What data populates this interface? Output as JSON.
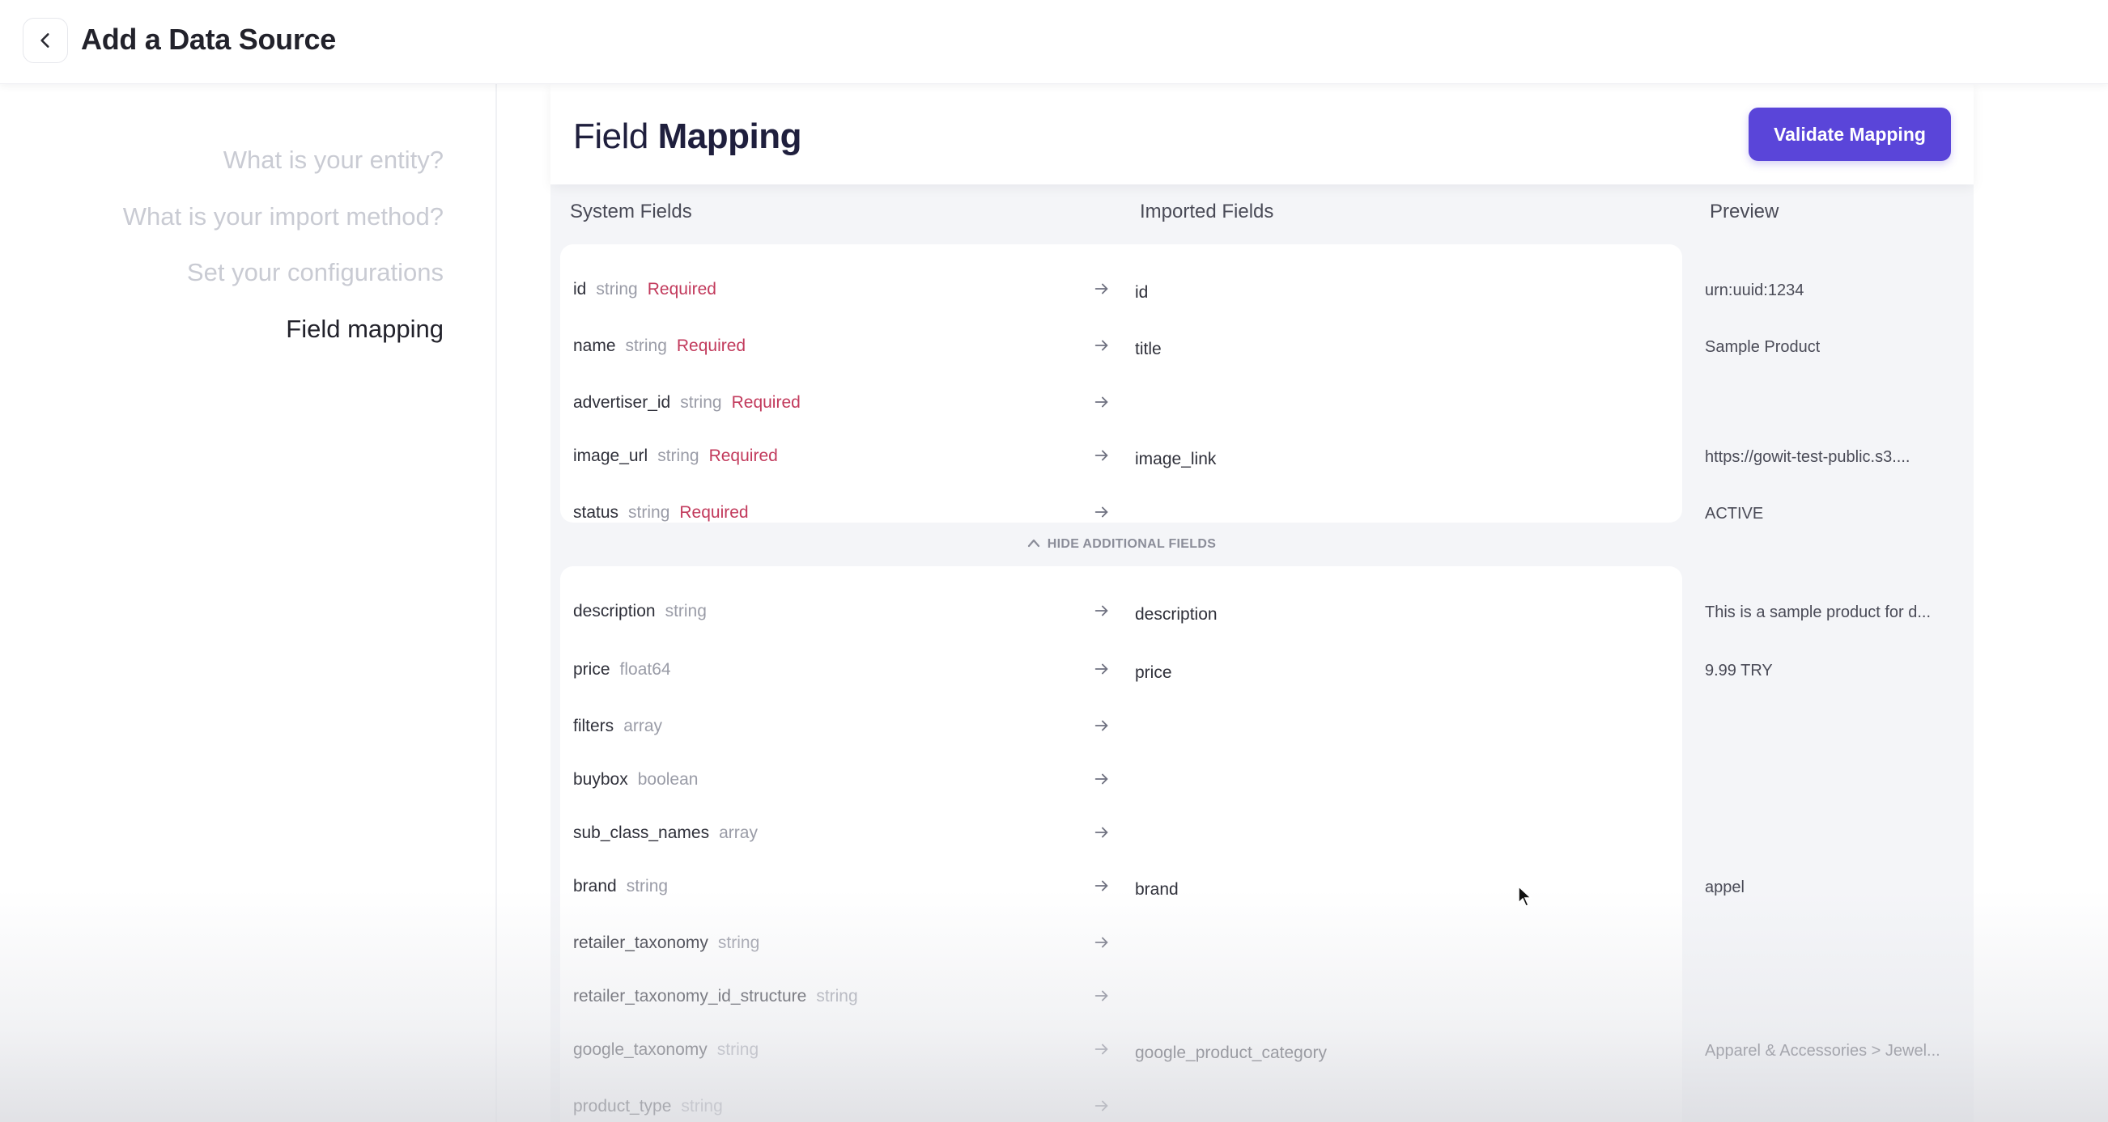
{
  "header": {
    "title": "Add a Data Source"
  },
  "sidebar": {
    "steps": [
      {
        "label": "What is your entity?"
      },
      {
        "label": "What is your import method?"
      },
      {
        "label": "Set your configurations"
      },
      {
        "label": "Field mapping"
      }
    ]
  },
  "main": {
    "title_light": "Field",
    "title_bold": "Mapping",
    "validate_label": "Validate Mapping",
    "columns": {
      "system": "System Fields",
      "imported": "Imported Fields",
      "preview": "Preview"
    },
    "toggle_label": "HIDE ADDITIONAL FIELDS"
  },
  "required_fields": [
    {
      "name": "id",
      "type": "string",
      "req": "Required",
      "imported": "id",
      "preview": "urn:uuid:1234"
    },
    {
      "name": "name",
      "type": "string",
      "req": "Required",
      "imported": "title",
      "preview": "Sample Product"
    },
    {
      "name": "advertiser_id",
      "type": "string",
      "req": "Required",
      "imported": "",
      "preview": ""
    },
    {
      "name": "image_url",
      "type": "string",
      "req": "Required",
      "imported": "image_link",
      "preview": "https://gowit-test-public.s3...."
    },
    {
      "name": "status",
      "type": "string",
      "req": "Required",
      "imported": "",
      "preview": "ACTIVE"
    }
  ],
  "additional_fields": [
    {
      "name": "description",
      "type": "string",
      "imported": "description",
      "preview": "This is a sample product for d..."
    },
    {
      "name": "price",
      "type": "float64",
      "imported": "price",
      "preview": "9.99 TRY"
    },
    {
      "name": "filters",
      "type": "array",
      "imported": "",
      "preview": ""
    },
    {
      "name": "buybox",
      "type": "boolean",
      "imported": "",
      "preview": ""
    },
    {
      "name": "sub_class_names",
      "type": "array",
      "imported": "",
      "preview": ""
    },
    {
      "name": "brand",
      "type": "string",
      "imported": "brand",
      "preview": "appel"
    },
    {
      "name": "retailer_taxonomy",
      "type": "string",
      "imported": "",
      "preview": ""
    },
    {
      "name": "retailer_taxonomy_id_structure",
      "type": "string",
      "imported": "",
      "preview": ""
    },
    {
      "name": "google_taxonomy",
      "type": "string",
      "imported": "google_product_category",
      "preview": "Apparel & Accessories > Jewel..."
    },
    {
      "name": "product_type",
      "type": "string",
      "imported": "",
      "preview": ""
    }
  ],
  "colors": {
    "accent": "#5a45d9",
    "required": "#c23a5c",
    "muted": "#9a9ca7",
    "background": "#f4f5f8"
  },
  "icons": {
    "back": "chevron-left-icon",
    "arrow": "arrow-right-icon",
    "toggle": "chevron-up-icon"
  }
}
